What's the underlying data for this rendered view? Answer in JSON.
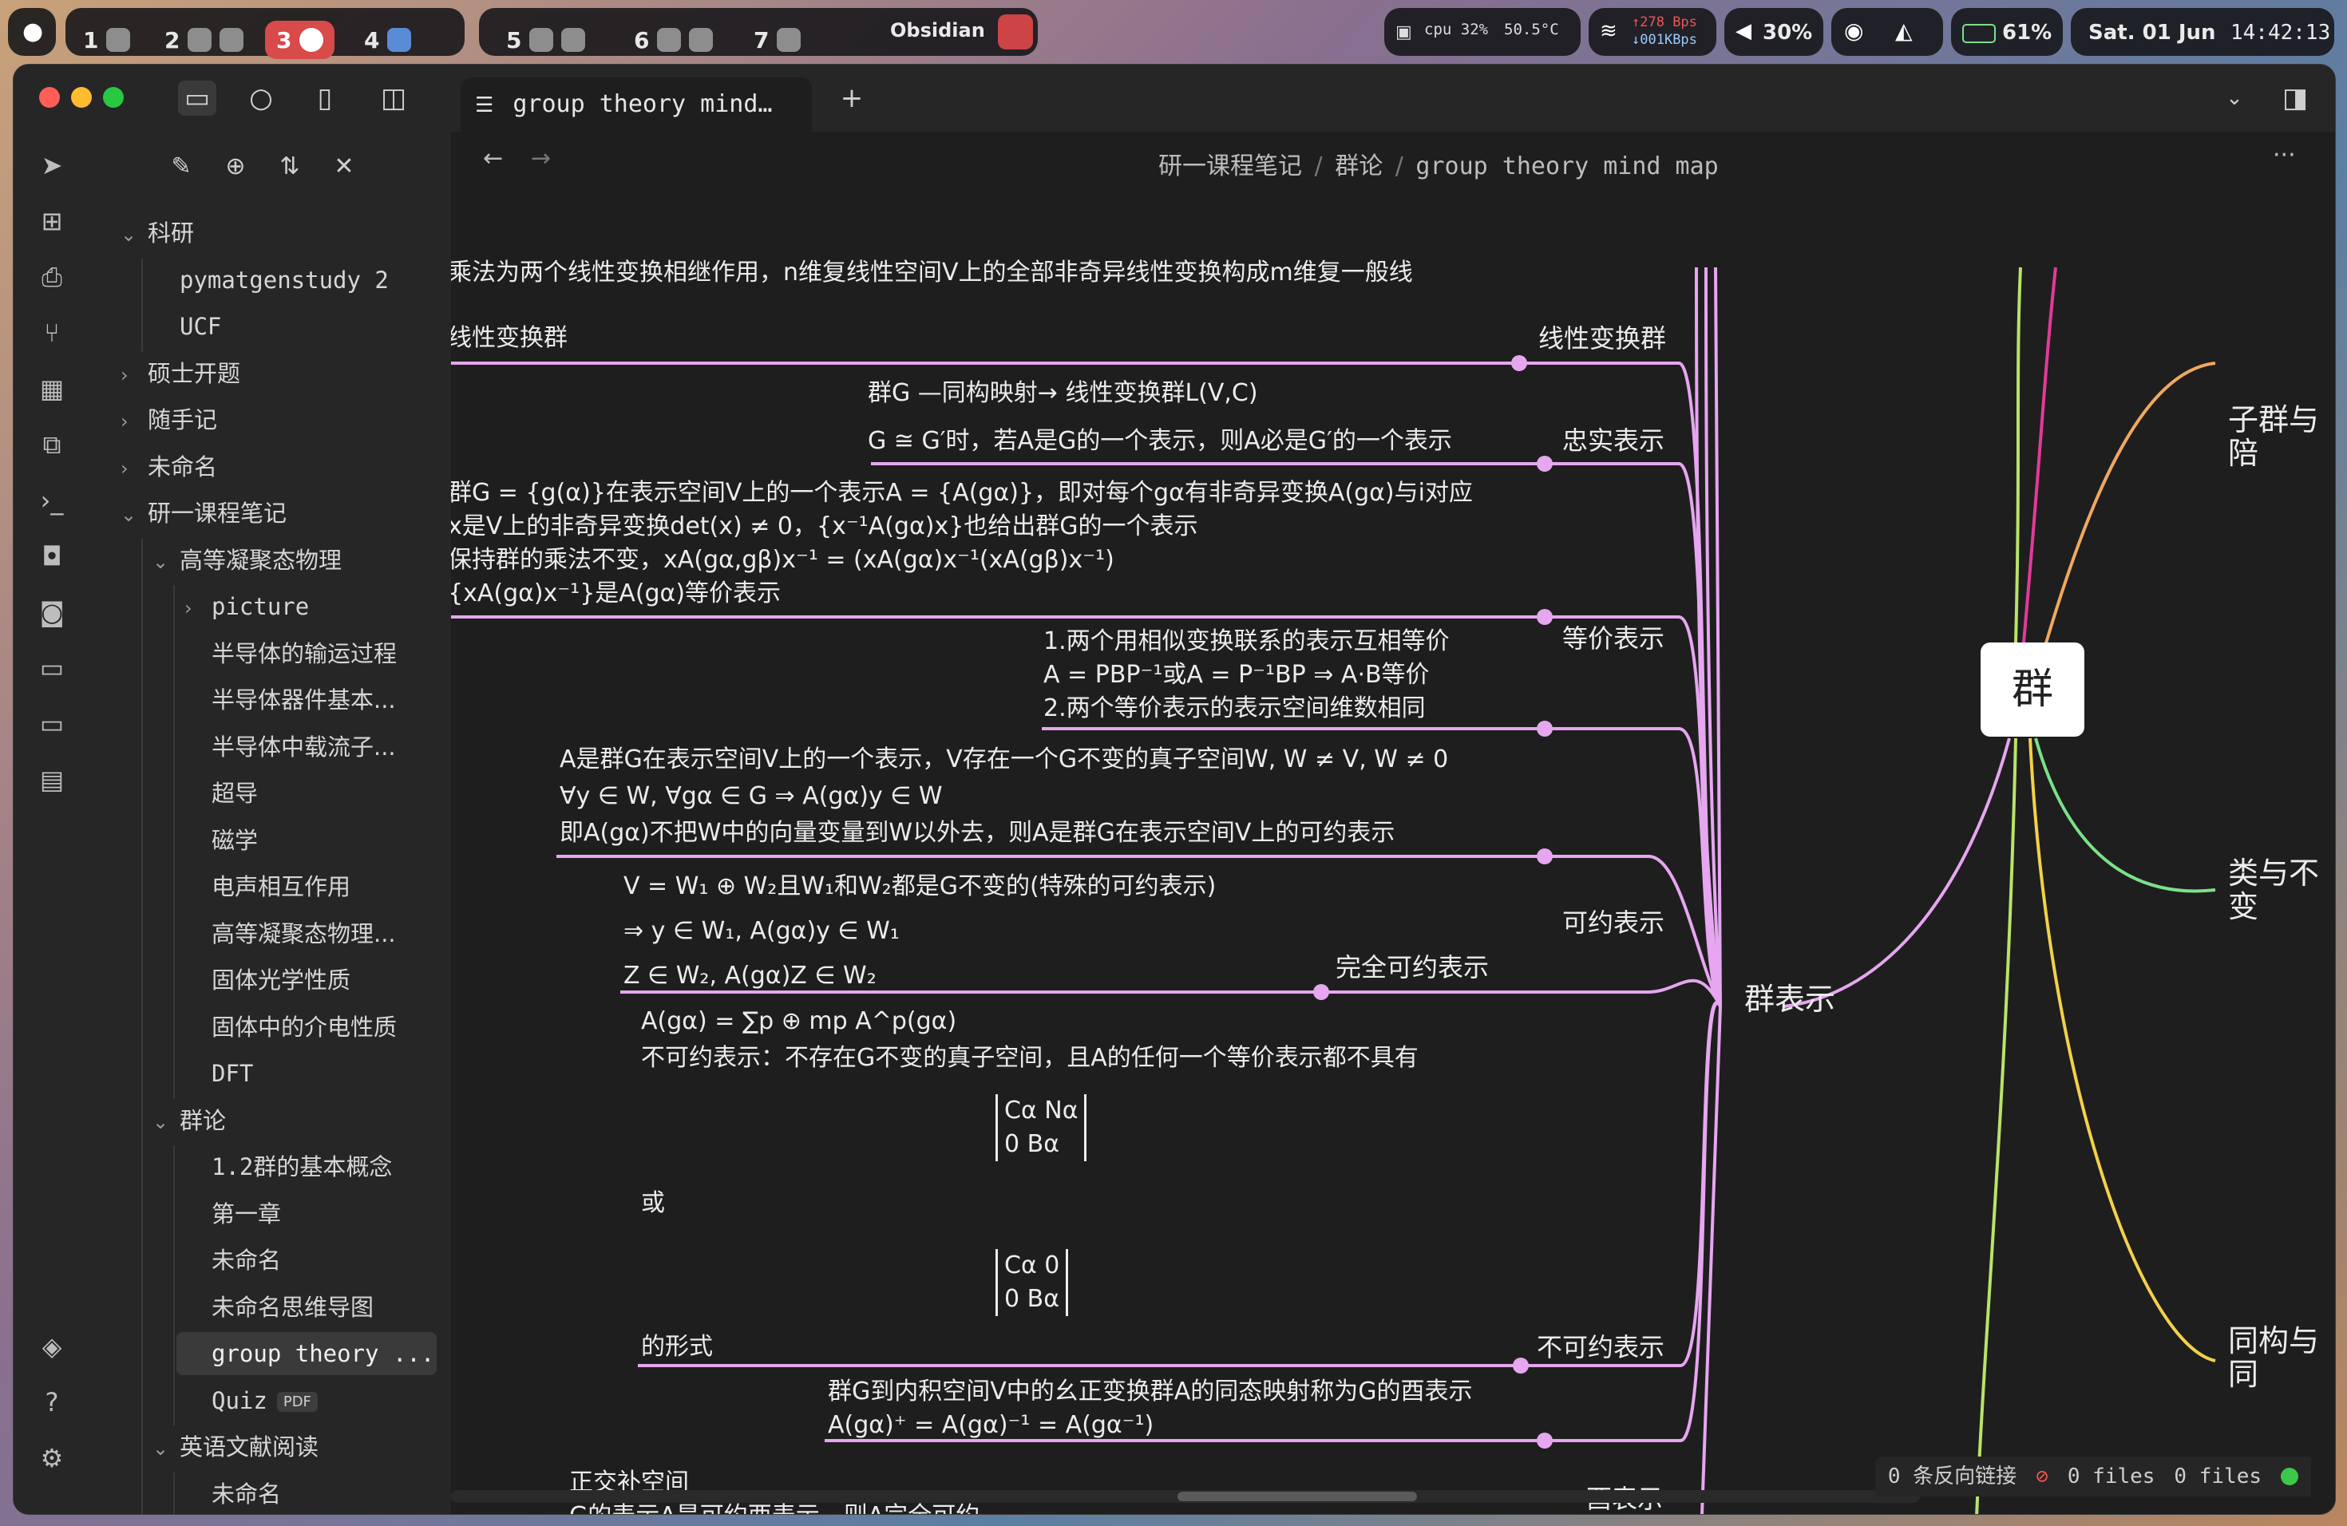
{
  "menubar": {
    "workspaces": [
      {
        "num": "1",
        "active": false
      },
      {
        "num": "2",
        "active": false
      },
      {
        "num": "3",
        "active": true
      },
      {
        "num": "4",
        "active": false
      },
      {
        "num": "5",
        "active": false
      },
      {
        "num": "6",
        "active": false
      },
      {
        "num": "7",
        "active": false
      }
    ],
    "app_name": "Obsidian",
    "cpu": "cpu 32%",
    "temp": "50.5°C",
    "net_up": "278 Bps",
    "net_down": "001KBps",
    "volume": "30%",
    "battery": "61%",
    "date": "Sat. 01 Jun",
    "time": "14:42:13"
  },
  "tab": {
    "title": "group theory mind…",
    "close": "×",
    "new": "+"
  },
  "breadcrumb": {
    "p1": "研一课程笔记",
    "sep1": "/",
    "p2": "群论",
    "sep2": "/",
    "p3": "group theory mind map",
    "more": "···"
  },
  "sidebar": {
    "items": [
      {
        "label": "科研",
        "indent": 0,
        "chevron": "⌄"
      },
      {
        "label": "pymatgenstudy 2",
        "indent": 1,
        "chevron": ""
      },
      {
        "label": "UCF",
        "indent": 1,
        "chevron": ""
      },
      {
        "label": "硕士开题",
        "indent": 0,
        "chevron": "›"
      },
      {
        "label": "随手记",
        "indent": 0,
        "chevron": "›"
      },
      {
        "label": "未命名",
        "indent": 0,
        "chevron": "›"
      },
      {
        "label": "研一课程笔记",
        "indent": 0,
        "chevron": "⌄"
      },
      {
        "label": "高等凝聚态物理",
        "indent": 1,
        "chevron": "⌄"
      },
      {
        "label": "picture",
        "indent": 2,
        "chevron": "›"
      },
      {
        "label": "半导体的输运过程",
        "indent": 2,
        "chevron": ""
      },
      {
        "label": "半导体器件基本...",
        "indent": 2,
        "chevron": ""
      },
      {
        "label": "半导体中载流子...",
        "indent": 2,
        "chevron": ""
      },
      {
        "label": "超导",
        "indent": 2,
        "chevron": ""
      },
      {
        "label": "磁学",
        "indent": 2,
        "chevron": ""
      },
      {
        "label": "电声相互作用",
        "indent": 2,
        "chevron": ""
      },
      {
        "label": "高等凝聚态物理...",
        "indent": 2,
        "chevron": ""
      },
      {
        "label": "固体光学性质",
        "indent": 2,
        "chevron": ""
      },
      {
        "label": "固体中的介电性质",
        "indent": 2,
        "chevron": ""
      },
      {
        "label": "DFT",
        "indent": 2,
        "chevron": ""
      },
      {
        "label": "群论",
        "indent": 1,
        "chevron": "⌄"
      },
      {
        "label": "1.2群的基本概念",
        "indent": 2,
        "chevron": ""
      },
      {
        "label": "第一章",
        "indent": 2,
        "chevron": ""
      },
      {
        "label": "未命名",
        "indent": 2,
        "chevron": ""
      },
      {
        "label": "未命名思维导图",
        "indent": 2,
        "chevron": ""
      },
      {
        "label": "group theory ...",
        "indent": 2,
        "chevron": "",
        "selected": true
      },
      {
        "label": "Quiz",
        "indent": 2,
        "chevron": "",
        "badge": "PDF"
      },
      {
        "label": "英语文献阅读",
        "indent": 1,
        "chevron": "⌄"
      },
      {
        "label": "未命名",
        "indent": 2,
        "chevron": ""
      }
    ]
  },
  "mindmap": {
    "root": "群",
    "right_branches": [
      "子群与陪",
      "类与不变",
      "同构与同"
    ],
    "hub": "群表示",
    "labels": {
      "linear": "线性变换群",
      "faithful": "忠实表示",
      "equivalent": "等价表示",
      "reducible": "可约表示",
      "complete": "完全可约表示",
      "irreducible": "不可约表示",
      "unitary": "酉表示"
    },
    "texts": {
      "t1": "乘法为两个线性变换相继作用，n维复线性空间V上的全部非奇异线性变换构成m维复一般线",
      "t2": "线性变换群",
      "t3": "群G —同构映射→ 线性变换群L(V,C)\nG ≅ G′时，若A是G的一个表示，则A必是G′的一个表示",
      "t4": "群G = {g(α)}在表示空间V上的一个表示A = {A(gα)}，即对每个gα有非奇异变换A(gα)与i对应\nx是V上的非奇异变换det(x) ≠ 0，{x⁻¹A(gα)x}也给出群G的一个表示\n保持群的乘法不变，xA(gα,gβ)x⁻¹ = (xA(gα)x⁻¹(xA(gβ)x⁻¹)\n{xA(gα)x⁻¹}是A(gα)等价表示",
      "t5": "1.两个用相似变换联系的表示互相等价\nA = PBP⁻¹或A = P⁻¹BP ⇒ A·B等价\n2.两个等价表示的表示空间维数相同",
      "t6": "A是群G在表示空间V上的一个表示，V存在一个G不变的真子空间W, W ≠ V, W ≠ 0\n∀y ∈ W, ∀gα ∈ G ⇒ A(gα)y ∈ W\n即A(gα)不把W中的向量变量到W以外去，则A是群G在表示空间V上的可约表示",
      "t7": "V = W₁ ⊕ W₂且W₁和W₂都是G不变的(特殊的可约表示)\n⇒ y ∈ W₁, A(gα)y ∈ W₁\nZ ∈ W₂, A(gα)Z ∈ W₂",
      "t8": "A(gα) = ∑p ⊕ mp A^p(gα)\n不可约表示：不存在G不变的真子空间，且A的任何一个等价表示都不具有",
      "m1": "Cα   Nα\n0    Bα",
      "or": "或",
      "m2": "Cα   0\n0    Bα",
      "form": "的形式",
      "t9": "群G到内积空间V中的幺正变换群A的同态映射称为G的酉表示\nA(gα)⁺ = A(gα)⁻¹ = A(gα⁻¹)",
      "t10": "正交补空间\nG的表示A是可约酉表示，则A完全可约\nA可约，则V中村子G不变的真子空间W，令V = W ⊕ W⊥，W⊥称为W的正交补空间"
    }
  },
  "status": {
    "backlinks": "0 条反向链接",
    "files1": "0 files",
    "files2": "0 files"
  },
  "colors": {
    "branch_pink": "#e6a6f0",
    "orange": "#f0a860",
    "green": "#7be08a",
    "yellow": "#f2d14a",
    "lime": "#b8e36a",
    "magenta": "#e23a9a"
  }
}
